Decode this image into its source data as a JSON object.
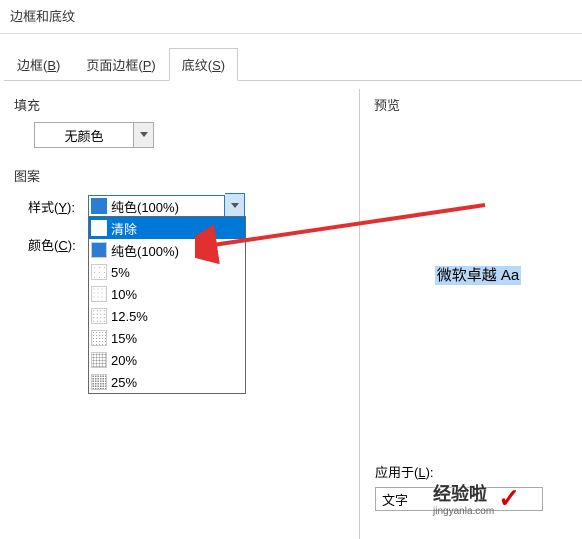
{
  "dialog": {
    "title": "边框和底纹"
  },
  "tabs": {
    "border": "边框(B)",
    "page_border": "页面边框(P)",
    "shading": "底纹(S)"
  },
  "left": {
    "fill_label": "填充",
    "fill_value": "无颜色",
    "pattern_label": "图案",
    "style_label": "样式(Y):",
    "style_value": "纯色(100%)",
    "color_label": "颜色(C):"
  },
  "dropdown": {
    "items": [
      {
        "label": "清除",
        "type": "white"
      },
      {
        "label": "纯色(100%)",
        "type": "blue"
      },
      {
        "label": "5%",
        "type": "dotted5"
      },
      {
        "label": "10%",
        "type": "dotted10"
      },
      {
        "label": "12.5%",
        "type": "dotted12"
      },
      {
        "label": "15%",
        "type": "dotted15"
      },
      {
        "label": "20%",
        "type": "dotted20"
      },
      {
        "label": "25%",
        "type": "dotted25"
      }
    ]
  },
  "right": {
    "preview_label": "预览",
    "preview_text": "微软卓越 Aa",
    "apply_label": "应用于(L):",
    "apply_value": "文字"
  },
  "watermark": {
    "text": "经验啦",
    "sub": "jingyanla.com"
  },
  "colors": {
    "highlight": "#0078d7",
    "preview_bg": "#b8d8f8",
    "swatch_blue": "#2b7cd3"
  }
}
